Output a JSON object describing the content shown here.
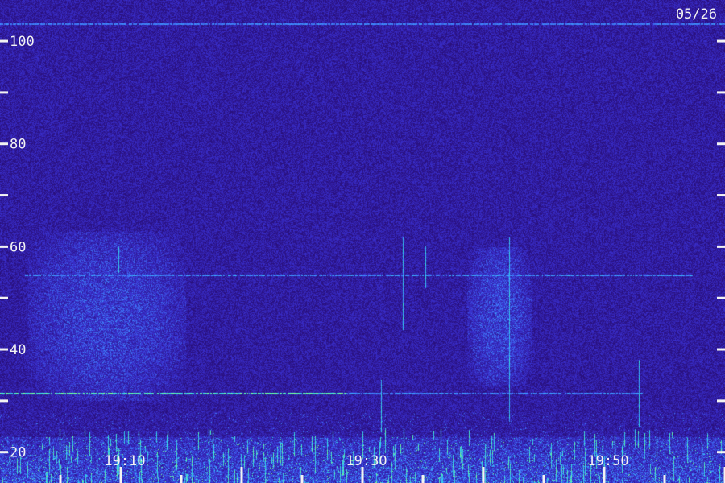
{
  "chart_data": {
    "type": "heatmap",
    "date_label": "05/26",
    "y_axis": {
      "range": [
        14,
        108
      ],
      "major_ticks": [
        20,
        40,
        60,
        80,
        100
      ],
      "major_tick_labels": [
        "20",
        "40",
        "60",
        "80",
        "100"
      ],
      "minor_ticks": [
        30,
        50,
        70,
        90
      ]
    },
    "x_axis": {
      "time_labels": [
        "19:10",
        "19:30",
        "19:50"
      ]
    },
    "colors": {
      "background": "#1a0f4e",
      "noise_low": "#2a1080",
      "noise_mid": "#3a30d0",
      "signal": "#3f8cff",
      "strong": "#30e0e8",
      "peak": "#7cff8c",
      "text": "#f2f2f2"
    },
    "features": {
      "horizontal_lines": [
        {
          "y_value": 103.5,
          "x_span": [
            0,
            900
          ],
          "strength": 0.45
        },
        {
          "y_value": 54.5,
          "x_span": [
            30,
            860
          ],
          "strength": 0.6
        },
        {
          "y_value": 31.5,
          "x_span": [
            0,
            430
          ],
          "strength": 1.0
        },
        {
          "y_value": 31.5,
          "x_span": [
            430,
            800
          ],
          "strength": 0.55
        }
      ],
      "diffuse_bursts": [
        {
          "x_span": [
            35,
            230
          ],
          "y_range": [
            30,
            63
          ],
          "strength": 0.7
        },
        {
          "x_span": [
            580,
            660
          ],
          "y_range": [
            33,
            60
          ],
          "strength": 0.75
        }
      ],
      "vertical_spikes": [
        {
          "x": 500,
          "y_range": [
            44,
            62
          ]
        },
        {
          "x": 528,
          "y_range": [
            52,
            60
          ]
        },
        {
          "x": 632,
          "y_range": [
            26,
            62
          ]
        },
        {
          "x": 147,
          "y_range": [
            55,
            60
          ]
        },
        {
          "x": 473,
          "y_range": [
            24,
            34
          ]
        },
        {
          "x": 793,
          "y_range": [
            25,
            38
          ]
        }
      ],
      "low_band": {
        "y_range": [
          14,
          23
        ],
        "strength": 1.0
      }
    }
  }
}
